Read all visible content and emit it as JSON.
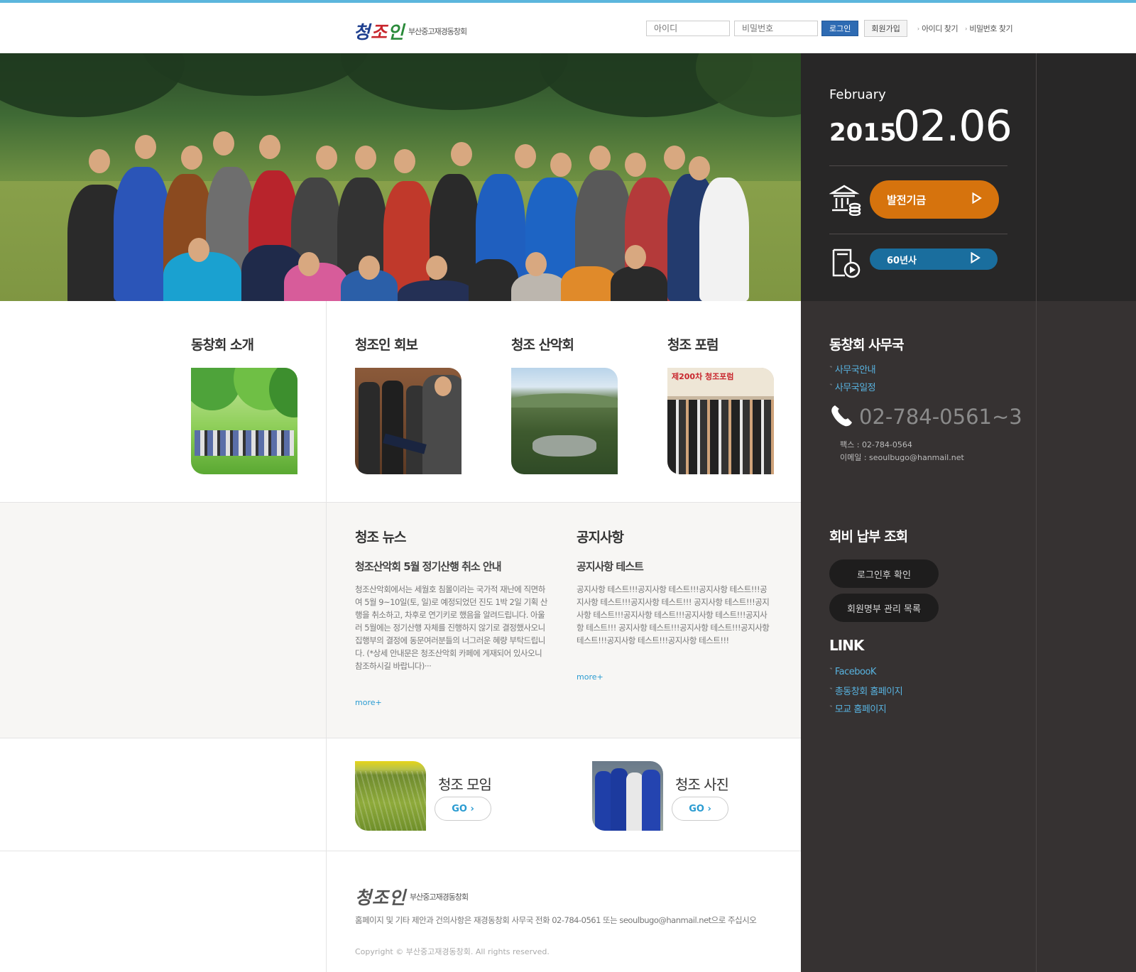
{
  "header": {
    "logo_script": [
      "청",
      "조",
      "인"
    ],
    "logo_sub": "부산중고재경동창회",
    "id_placeholder": "아이디",
    "pw_placeholder": "비밀번호",
    "login_label": "로그인",
    "join_label": "회원가입",
    "find_id": "아이디 찾기",
    "find_pw": "비밀번호 찾기"
  },
  "sidebar": {
    "month": "February",
    "year": "2015",
    "day": "02.06",
    "fund_label": "발전기금",
    "history_label": "60년사",
    "office_title": "동창회 사무국",
    "office_links": [
      "사무국안내",
      "사무국일정"
    ],
    "phone": "02-784-0561~3",
    "fax": "팩스 : 02-784-0564",
    "email": "이메일 : seoulbugo@hanmail.net",
    "fee_title": "회비 납부 조회",
    "fee_buttons": [
      "로그인후 확인",
      "회원명부 관리 목록"
    ],
    "link_title": "LINK",
    "links": [
      "FacebooK",
      "총동창회 홈페이지",
      "모교 홈페이지"
    ],
    "colors": {
      "accent_orange": "#d6730d",
      "accent_blue": "#1a6e9e",
      "link_blue": "#58b3e0"
    }
  },
  "sections": [
    {
      "title": "동창회 소개"
    },
    {
      "title": "청조인 회보"
    },
    {
      "title": "청조 산악회"
    },
    {
      "title": "청조 포럼"
    }
  ],
  "forum_banner": "제200차 청조포럼",
  "news": {
    "title": "청조 뉴스",
    "headline": "청조산악회 5월 정기산행 취소 안내",
    "body": "청조산악회에서는 세월호 침몰이라는 국가적 재난에 직면하여 5월 9~10일(토, 일)로 예정되었던 진도 1박 2일 기획 산행을 취소하고, 차후로 연기키로 했음을 알려드립니다. 아울러 5월에는 정기산행 자체를 진행하지 않기로 결정했사오니 집행부의 결정에 동문여러분들의 너그러운 혜량 부탁드립니다. (*상세 안내문은 청조산악회 카페에 게재되어 있사오니 참조하시길 바랍니다)···",
    "more": "more+"
  },
  "notice": {
    "title": "공지사항",
    "headline": "공지사항 테스트",
    "body": "공지사항 테스트!!!공지사항 테스트!!!공지사항 테스트!!!공지사항 테스트!!!공지사항 테스트!!! 공지사항 테스트!!!공지사항 테스트!!!공지사항 테스트!!!공지사항 테스트!!!공지사항 테스트!!! 공지사항 테스트!!!공지사항 테스트!!!공지사항 테스트!!!공지사항 테스트!!!공지사항 테스트!!!",
    "more": "more+"
  },
  "gallery": [
    {
      "title": "청조 모임",
      "go": "GO"
    },
    {
      "title": "청조 사진",
      "go": "GO"
    }
  ],
  "footer": {
    "logo_sub": "부산중고재경동창회",
    "text": "홈페이지 및 기타 제안과 건의사항은 재경동창회 사무국 전화 02-784-0561 또는 seoulbugo@hanmail.net으로 주십시오",
    "copyright": "Copyright © 부산중고재경동창회. All rights reserved."
  }
}
